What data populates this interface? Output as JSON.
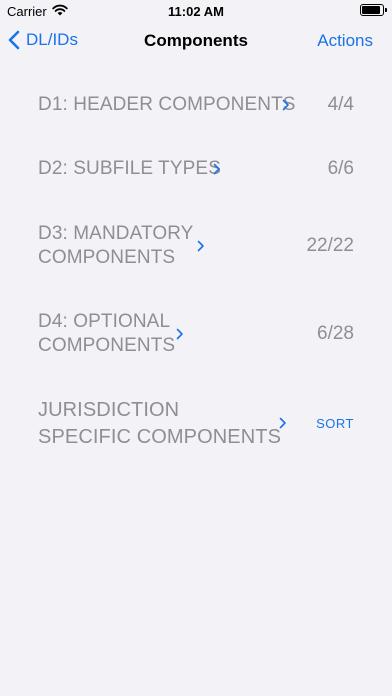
{
  "status_bar": {
    "carrier": "Carrier",
    "time": "11:02 AM"
  },
  "nav": {
    "back_label": "DL/IDs",
    "title": "Components",
    "action_label": "Actions"
  },
  "rows": [
    {
      "label": "D1: HEADER COMPONENTS",
      "value": "4/4"
    },
    {
      "label": "D2: SUBFILE TYPES",
      "value": "6/6"
    },
    {
      "label_lines": [
        "D3: MANDATORY",
        "COMPONENTS"
      ],
      "value": "22/22"
    },
    {
      "label_lines": [
        "D4: OPTIONAL",
        "COMPONENTS"
      ],
      "value": "6/28"
    },
    {
      "label_lines": [
        "JURISDICTION",
        "SPECIFIC COMPONENTS"
      ],
      "action": "SORT"
    }
  ],
  "colors": {
    "accent": "#1a73e8",
    "label": "#8e8e93",
    "background": "#f2f2f7"
  }
}
